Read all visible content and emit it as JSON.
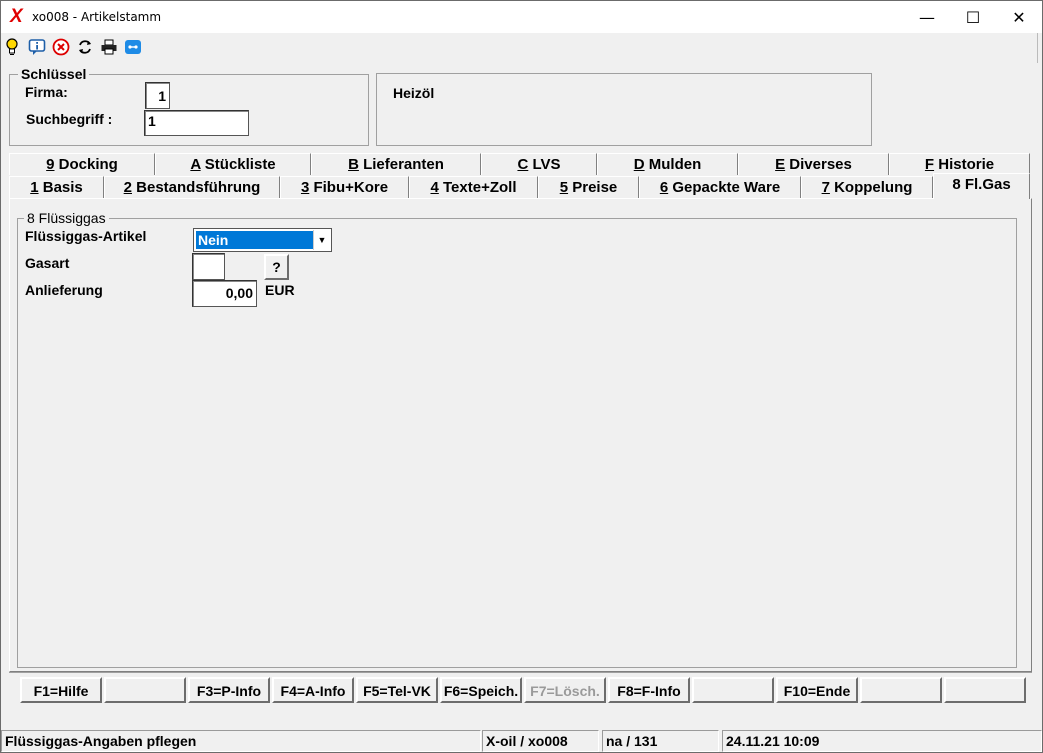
{
  "window": {
    "title": "xo008 - Artikelstamm",
    "minimize": "—",
    "maximize": "☐",
    "close": "✕"
  },
  "toolbar": {
    "icons": [
      "lightbulb-icon",
      "info-icon",
      "cancel-icon",
      "refresh-icon",
      "print-icon",
      "chat-icon"
    ]
  },
  "key_group": {
    "legend": "Schlüssel",
    "firma_label": "Firma:",
    "firma_value": "1",
    "suchbegriff_label": "Suchbegriff :",
    "suchbegriff_value": "1"
  },
  "article_name": "Heizöl",
  "tabs_row1": [
    {
      "key": "9",
      "label": " Docking"
    },
    {
      "key": "A",
      "label": " Stückliste"
    },
    {
      "key": "B",
      "label": " Lieferanten"
    },
    {
      "key": "C",
      "label": " LVS"
    },
    {
      "key": "D",
      "label": " Mulden"
    },
    {
      "key": "E",
      "label": " Diverses"
    },
    {
      "key": "F",
      "label": " Historie"
    }
  ],
  "tabs_row2": [
    {
      "key": "1",
      "label": " Basis"
    },
    {
      "key": "2",
      "label": " Bestandsführung"
    },
    {
      "key": "3",
      "label": " Fibu+Kore"
    },
    {
      "key": "4",
      "label": " Texte+Zoll"
    },
    {
      "key": "5",
      "label": " Preise"
    },
    {
      "key": "6",
      "label": " Gepackte Ware"
    },
    {
      "key": "7",
      "label": " Koppelung"
    },
    {
      "key": "8",
      "label": " Fl.Gas"
    }
  ],
  "gas_group": {
    "legend": "8 Flüssiggas",
    "artikel_label": "Flüssiggas-Artikel",
    "artikel_value": "Nein",
    "gasart_label": "Gasart",
    "gasart_value": "",
    "help_button": "?",
    "anlieferung_label": "Anlieferung",
    "anlieferung_value": "0,00",
    "currency": "EUR"
  },
  "function_keys": [
    "F1=Hilfe",
    "",
    "F3=P-Info",
    "F4=A-Info",
    "F5=Tel-VK",
    "F6=Speich.",
    "F7=Lösch.",
    "F8=F-Info",
    "",
    "F10=Ende",
    "",
    ""
  ],
  "status_bar": {
    "message": "Flüssiggas-Angaben pflegen",
    "system": "X-oil / xo008",
    "user": "na / 131",
    "datetime": "24.11.21 10:09"
  },
  "colors": {
    "selection": "#0078d7",
    "app_icon": "#e00000"
  }
}
